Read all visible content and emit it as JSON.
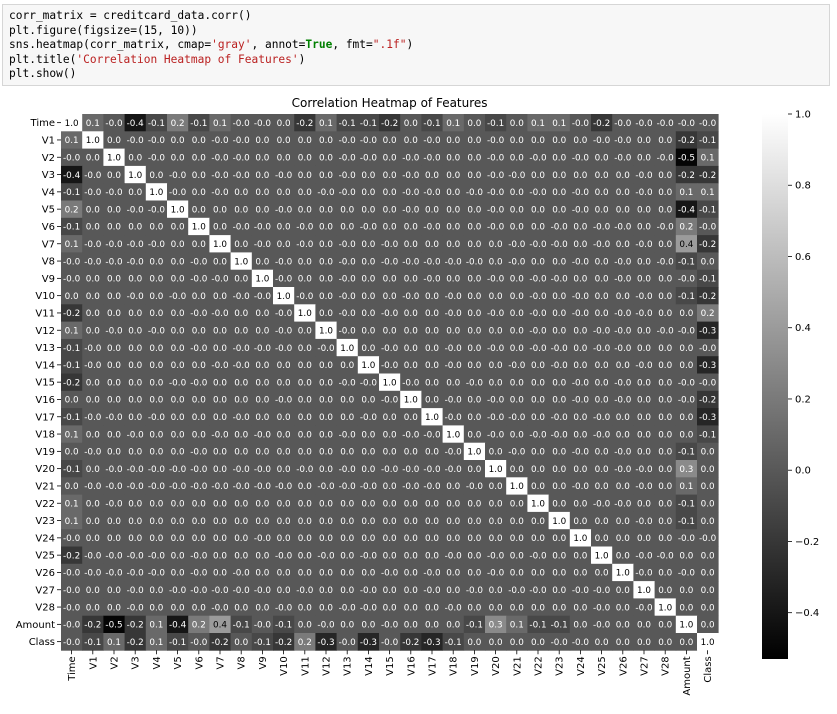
{
  "code": {
    "lines": [
      [
        {
          "t": "corr_matrix = creditcard_data.corr()"
        }
      ],
      [
        {
          "t": "plt.figure(figsize=(15, 10))"
        }
      ],
      [
        {
          "t": "sns.heatmap(corr_matrix, cmap="
        },
        {
          "t": "'gray'",
          "c": "str"
        },
        {
          "t": ", annot="
        },
        {
          "t": "True",
          "c": "kw"
        },
        {
          "t": ", fmt="
        },
        {
          "t": "\".1f\"",
          "c": "str"
        },
        {
          "t": ")"
        }
      ],
      [
        {
          "t": "plt.title("
        },
        {
          "t": "'Correlation Heatmap of Features'",
          "c": "str"
        },
        {
          "t": ")"
        }
      ],
      [
        {
          "t": "plt.show()"
        }
      ]
    ]
  },
  "chart_data": {
    "type": "heatmap",
    "title": "Correlation Heatmap of Features",
    "colormap": "gray",
    "annot_format": ".1f",
    "labels": [
      "Time",
      "V1",
      "V2",
      "V3",
      "V4",
      "V5",
      "V6",
      "V7",
      "V8",
      "V9",
      "V10",
      "V11",
      "V12",
      "V13",
      "V14",
      "V15",
      "V16",
      "V17",
      "V18",
      "V19",
      "V20",
      "V21",
      "V22",
      "V23",
      "V24",
      "V25",
      "V26",
      "V27",
      "V28",
      "Amount",
      "Class"
    ],
    "vmin": -0.53,
    "vmax": 1.0,
    "colorbar_ticks": [
      1.0,
      0.8,
      0.6,
      0.4,
      0.2,
      0.0,
      -0.2,
      -0.4
    ],
    "colorbar_tick_labels": [
      "1.0",
      "0.8",
      "0.6",
      "0.4",
      "0.2",
      "0.0",
      "−0.2",
      "−0.4"
    ],
    "matrix_text": [
      "1.0 0.1 -0.0 -0.4 -0.1 0.2 -0.1 0.1 -0.0 -0.0 0.0 -0.2 0.1 -0.1 -0.1 -0.2 0.0 -0.1 0.1 0.0 -0.1 0.0 0.1 0.1 -0.0 -0.2 -0.0 -0.0 -0.0 -0.0 -0.0",
      "0.1 1.0 0.0 -0.0 -0.0 0.0 0.0 -0.0 -0.0 0.0 0.0 0.0 0.0 -0.0 -0.0 0.0 0.0 -0.0 0.0 0.0 -0.0 0.0 0.0 0.0 0.0 -0.0 -0.0 0.0 0.0 -0.2 -0.1",
      "-0.0 0.0 1.0 0.0 -0.0 0.0 0.0 -0.0 -0.0 0.0 0.0 0.0 0.0 -0.0 -0.0 0.0 -0.0 -0.0 0.0 0.0 -0.0 0.0 -0.0 0.0 -0.0 0.0 -0.0 0.0 -0.0 -0.5 0.1",
      "-0.4 -0.0 0.0 1.0 0.0 -0.0 0.0 -0.0 -0.0 0.0 -0.0 0.0 0.0 -0.0 0.0 0.0 -0.0 0.0 0.0 0.0 -0.0 -0.0 0.0 0.0 0.0 0.0 0.0 -0.0 0.0 -0.2 -0.2",
      "-0.1 -0.0 -0.0 0.0 1.0 -0.0 0.0 -0.0 0.0 0.0 0.0 0.0 -0.0 -0.0 0.0 0.0 -0.0 -0.0 0.0 -0.0 -0.0 0.0 -0.0 0.0 -0.0 0.0 0.0 -0.0 0.0 0.1 0.1",
      "0.2 0.0 0.0 -0.0 -0.0 1.0 0.0 0.0 0.0 0.0 -0.0 0.0 0.0 0.0 0.0 0.0 -0.0 0.0 0.0 0.0 -0.0 0.0 0.0 0.0 -0.0 0.0 0.0 0.0 0.0 -0.4 -0.1",
      "-0.1 0.0 0.0 0.0 0.0 0.0 1.0 0.0 -0.0 -0.0 0.0 -0.0 0.0 0.0 -0.0 0.0 0.0 -0.0 0.0 0.0 -0.0 0.0 0.0 -0.0 0.0 -0.0 -0.0 0.0 -0.0 0.2 -0.0",
      "0.1 -0.0 -0.0 -0.0 -0.0 0.0 0.0 1.0 0.0 -0.0 0.0 -0.0 0.0 -0.0 0.0 -0.0 0.0 0.0 0.0 0.0 0.0 -0.0 -0.0 -0.0 0.0 -0.0 0.0 -0.0 0.0 0.4 -0.2",
      "-0.0 -0.0 -0.0 -0.0 0.0 0.0 -0.0 0.0 1.0 0.0 -0.0 0.0 0.0 -0.0 0.0 -0.0 -0.0 -0.0 -0.0 -0.0 0.0 -0.0 0.0 0.0 -0.0 0.0 -0.0 0.0 -0.0 -0.1 0.0",
      "-0.0 0.0 0.0 0.0 0.0 0.0 -0.0 -0.0 0.0 1.0 -0.0 0.0 0.0 -0.0 0.0 0.0 0.0 -0.0 0.0 0.0 -0.0 0.0 -0.0 -0.0 0.0 0.0 -0.0 0.0 0.0 -0.0 -0.1",
      "0.0 0.0 0.0 -0.0 0.0 -0.0 0.0 0.0 -0.0 -0.0 1.0 -0.0 0.0 -0.0 0.0 0.0 -0.0 0.0 -0.0 0.0 0.0 0.0 -0.0 0.0 -0.0 0.0 0.0 -0.0 0.0 -0.1 -0.2",
      "-0.2 0.0 0.0 0.0 0.0 0.0 -0.0 -0.0 0.0 0.0 -0.0 1.0 0.0 -0.0 0.0 -0.0 0.0 0.0 -0.0 0.0 -0.0 0.0 -0.0 0.0 -0.0 0.0 -0.0 -0.0 0.0 0.0 0.2",
      "0.1 0.0 -0.0 0.0 -0.0 0.0 0.0 0.0 0.0 0.0 -0.0 0.0 1.0 -0.0 0.0 0.0 0.0 0.0 0.0 0.0 0.0 0.0 -0.0 0.0 0.0 -0.0 -0.0 0.0 -0.0 -0.0 -0.3",
      "-0.1 -0.0 0.0 0.0 0.0 0.0 -0.0 0.0 -0.0 -0.0 -0.0 0.0 -0.0 1.0 0.0 -0.0 0.0 0.0 -0.0 0.0 -0.0 0.0 -0.0 -0.0 0.0 -0.0 -0.0 0.0 0.0 0.0 -0.0",
      "-0.1 -0.0 0.0 0.0 0.0 0.0 0.0 -0.0 -0.0 0.0 0.0 0.0 0.0 0.0 1.0 -0.0 0.0 0.0 -0.0 0.0 0.0 -0.0 0.0 -0.0 0.0 0.0 0.0 -0.0 0.0 0.0 -0.3",
      "-0.2 0.0 0.0 0.0 0.0 -0.0 -0.0 0.0 0.0 0.0 0.0 0.0 0.0 -0.0 -0.0 1.0 -0.0 0.0 0.0 -0.0 0.0 0.0 0.0 0.0 -0.0 0.0 -0.0 0.0 0.0 -0.0 -0.0",
      "0.0 0.0 0.0 0.0 0.0 0.0 0.0 0.0 0.0 0.0 -0.0 0.0 0.0 0.0 0.0 -0.0 1.0 0.0 -0.0 0.0 -0.0 0.0 0.0 0.0 -0.0 0.0 -0.0 0.0 0.0 -0.0 -0.2",
      "-0.1 -0.0 -0.0 0.0 -0.0 0.0 0.0 0.0 -0.0 0.0 0.0 0.0 0.0 0.0 -0.0 0.0 0.0 1.0 -0.0 0.0 -0.0 -0.0 0.0 -0.0 0.0 -0.0 0.0 0.0 0.0 0.0 -0.3",
      "0.1 0.0 0.0 -0.0 0.0 0.0 0.0 -0.0 0.0 -0.0 0.0 0.0 0.0 -0.0 0.0 0.0 -0.0 -0.0 1.0 0.0 -0.0 0.0 -0.0 -0.0 0.0 -0.0 0.0 0.0 0.0 0.0 -0.1",
      "0.0 -0.0 0.0 0.0 0.0 0.0 -0.0 0.0 0.0 0.0 0.0 0.0 0.0 0.0 0.0 0.0 0.0 0.0 -0.0 1.0 0.0 -0.0 0.0 0.0 -0.0 0.0 -0.0 0.0 0.0 -0.1 0.0",
      "-0.1 0.0 -0.0 -0.0 -0.0 -0.0 -0.0 0.0 -0.0 -0.0 0.0 -0.0 0.0 -0.0 0.0 -0.0 -0.0 -0.0 -0.0 0.0 1.0 0.0 0.0 0.0 0.0 0.0 -0.0 -0.0 0.0 0.3 0.0",
      "0.0 -0.0 -0.0 -0.0 -0.0 -0.0 -0.0 -0.0 -0.0 -0.0 -0.0 0.0 -0.0 -0.0 -0.0 0.0 -0.0 -0.0 0.0 -0.0 0.0 1.0 0.0 0.0 -0.0 0.0 0.0 -0.0 0.0 0.1 0.0",
      "0.1 0.0 -0.0 0.0 0.0 0.0 0.0 0.0 0.0 0.0 0.0 0.0 0.0 0.0 0.0 0.0 0.0 0.0 0.0 0.0 0.0 0.0 1.0 0.0 0.0 -0.0 -0.0 0.0 0.0 -0.1 0.0",
      "0.1 0.0 0.0 0.0 0.0 0.0 0.0 0.0 0.0 0.0 0.0 0.0 0.0 0.0 0.0 0.0 0.0 0.0 0.0 0.0 0.0 0.0 0.0 1.0 0.0 0.0 0.0 -0.0 0.0 -0.1 0.0",
      "-0.0 0.0 0.0 0.0 0.0 0.0 0.0 0.0 0.0 -0.0 0.0 0.0 0.0 0.0 0.0 0.0 0.0 0.0 0.0 0.0 0.0 0.0 0.0 0.0 1.0 0.0 0.0 0.0 0.0 -0.0 -0.0",
      "-0.2 -0.0 -0.0 -0.0 -0.0 0.0 -0.0 0.0 0.0 0.0 -0.0 0.0 -0.0 0.0 -0.0 0.0 0.0 0.0 -0.0 0.0 -0.0 0.0 -0.0 0.0 0.0 1.0 0.0 -0.0 -0.0 0.0 0.0",
      "-0.0 -0.0 -0.0 -0.0 -0.0 0.0 -0.0 0.0 -0.0 0.0 0.0 0.0 0.0 0.0 0.0 -0.0 0.0 -0.0 0.0 0.0 -0.0 0.0 0.0 0.0 0.0 0.0 1.0 -0.0 0.0 -0.0 0.0",
      "-0.0 0.0 0.0 -0.0 0.0 -0.0 -0.0 -0.0 -0.0 -0.0 0.0 -0.0 0.0 0.0 -0.0 0.0 0.0 -0.0 0.0 -0.0 0.0 -0.0 -0.0 0.0 -0.0 -0.0 0.0 1.0 0.0 0.0 0.0",
      "-0.0 0.0 0.0 -0.0 0.0 0.0 0.0 -0.0 0.0 0.0 -0.0 0.0 0.0 -0.0 -0.0 0.0 0.0 0.0 -0.0 0.0 0.0 0.0 0.0 0.0 0.0 -0.0 0.0 -0.0 1.0 0.0 0.0",
      "-0.0 -0.2 -0.5 -0.2 0.1 -0.4 0.2 0.4 -0.1 -0.0 -0.1 0.0 -0.0 0.0 0.0 -0.0 0.0 0.0 0.0 -0.1 0.3 0.1 -0.1 -0.1 0.0 -0.0 0.0 0.0 0.0 1.0 0.0",
      "-0.0 -0.1 0.1 -0.2 0.1 -0.1 -0.0 -0.2 0.0 -0.1 -0.2 0.2 -0.3 -0.0 -0.3 -0.0 -0.2 -0.3 -0.1 0.0 0.0 0.0 0.0 -0.0 -0.0 0.0 0.0 0.0 0.0 0.0 1.0"
    ]
  }
}
